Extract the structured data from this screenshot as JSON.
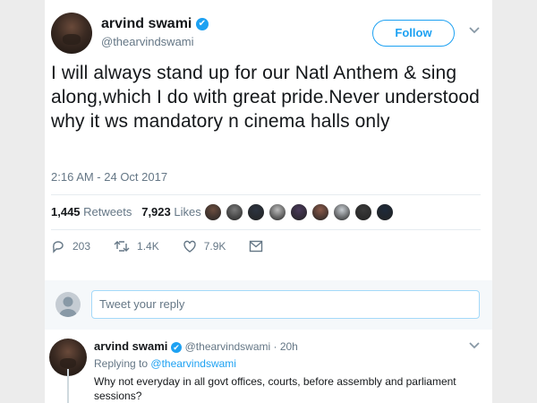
{
  "tweet": {
    "author": {
      "name": "arvind swami",
      "handle": "@thearvindswami",
      "verified_glyph": "✔"
    },
    "follow_label": "Follow",
    "text": "I will always stand up for our Natl Anthem & sing along,which I do with great pride.Never understood why it ws mandatory n cinema halls only",
    "timestamp": "2:16 AM - 24 Oct 2017",
    "retweets_count": "1,445",
    "retweets_label": "Retweets",
    "likes_count": "7,923",
    "likes_label": "Likes",
    "likers_colors": [
      "#6b4d3f",
      "#7a7a7a",
      "#2d3440",
      "#bcbcbc",
      "#4a3a5a",
      "#8a5a4a",
      "#c8cdd2",
      "#3a3a3a",
      "#1e2a3a"
    ],
    "actions": {
      "replies": "203",
      "retweets": "1.4K",
      "likes": "7.9K"
    }
  },
  "reply_box": {
    "placeholder": "Tweet your reply"
  },
  "reply": {
    "name": "arvind swami",
    "handle_time": "@thearvindswami · 20h",
    "replying_prefix": "Replying to",
    "replying_handle": "@thearvindswami",
    "text": "Why not everyday in all govt offices, courts, before assembly and parliament sessions?"
  },
  "colors": {
    "accent": "#1da1f2",
    "muted": "#657786",
    "background": "#ececec"
  }
}
